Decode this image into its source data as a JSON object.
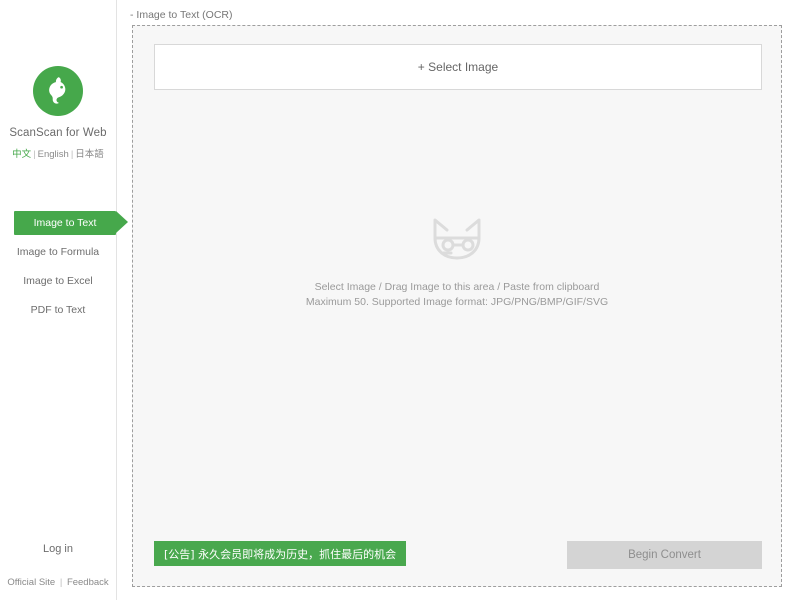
{
  "sidebar": {
    "logo_icon": "scanscan-cat-logo-icon",
    "brand": "ScanScan for Web",
    "languages": [
      {
        "label": "中文",
        "active": true
      },
      {
        "label": "English",
        "active": false
      },
      {
        "label": "日本語",
        "active": false
      }
    ],
    "lang_separator": "|",
    "nav": [
      {
        "label": "Image to Text",
        "active": true
      },
      {
        "label": "Image to Formula",
        "active": false
      },
      {
        "label": "Image to Excel",
        "active": false
      },
      {
        "label": "PDF to Text",
        "active": false
      }
    ],
    "login_label": "Log in",
    "footer": {
      "official_site": "Official Site",
      "separator": "|",
      "feedback": "Feedback"
    }
  },
  "main": {
    "breadcrumb": "- Image to Text (OCR)",
    "select_image_label": "+ Select Image",
    "drop_icon": "cat-outline-icon",
    "hint_line_1": "Select Image / Drag Image to this area / Paste from clipboard",
    "hint_line_2": "Maximum 50. Supported Image format: JPG/PNG/BMP/GIF/SVG",
    "promo_text": "[公告] 永久会员即将成为历史，抓住最后的机会",
    "convert_label": "Begin Convert"
  },
  "colors": {
    "brand_green": "#46a84b",
    "promo_green": "#49a84e",
    "disabled_button": "#d4d4d4",
    "dropzone_bg": "#f7f7f7"
  }
}
